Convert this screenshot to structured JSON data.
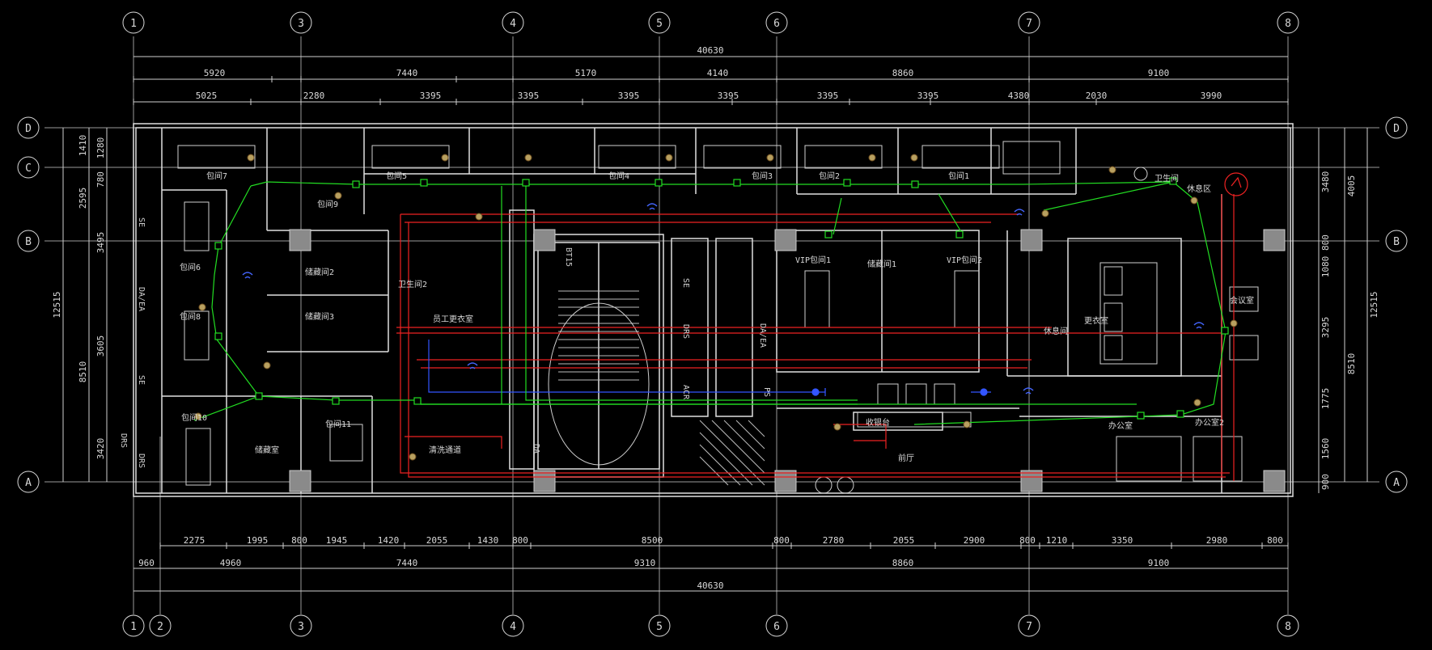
{
  "colors": {
    "background": "#000000",
    "lines": "#d9d9d9",
    "green_wiring": "#22dd22",
    "red_wiring": "#ee2222",
    "blue_wiring": "#3355ff",
    "fixture": "#b8a060"
  },
  "grid": {
    "top_labels": [
      "1",
      "3",
      "4",
      "5",
      "6",
      "7",
      "8"
    ],
    "bottom_labels": [
      "1",
      "2",
      "3",
      "4",
      "5",
      "6",
      "7",
      "8"
    ],
    "row_labels": [
      "D",
      "C",
      "B",
      "A"
    ]
  },
  "dimensions": {
    "total_top": "40630",
    "total_bottom": "40630",
    "top_row1": [
      "5920",
      "7440",
      "5170",
      "4140",
      "8860",
      "9100"
    ],
    "top_row2": [
      "5025",
      "2280",
      "3395",
      "3395",
      "3395",
      "3395",
      "3395",
      "3395",
      "4380",
      "2030",
      "3990"
    ],
    "bottom_row1": [
      "2275",
      "1995",
      "800",
      "1945",
      "1420",
      "2055",
      "1430",
      "800",
      "8500",
      "800",
      "2780",
      "2055",
      "2900",
      "800",
      "1210",
      "3350",
      "2980",
      "800"
    ],
    "bottom_row2": [
      "960",
      "4960",
      "7440",
      "9310",
      "8860",
      "9100"
    ],
    "left_total": "12515",
    "left_outer": [
      "2595",
      "8510",
      "3420"
    ],
    "left_inner": [
      "1410",
      "1280",
      "780",
      "3495",
      "3605"
    ],
    "right_total": "12515",
    "right_outer": [
      "4005",
      "8510"
    ],
    "right_inner": [
      "3480",
      "800",
      "1080",
      "3295",
      "1775",
      "1560",
      "900"
    ]
  },
  "rooms": [
    "包间7",
    "包间6",
    "包间5",
    "包间4",
    "包间3",
    "包间2",
    "包间1",
    "包间8",
    "包间9",
    "包间10",
    "包间11",
    "储藏间2",
    "储藏间3",
    "储藏间1",
    "卫生间2",
    "员工更衣室",
    "清洗通道",
    "储藏室",
    "VIP包间1",
    "VIP包间2",
    "卫生间",
    "休息区",
    "休息间",
    "更衣室",
    "会议室",
    "办公室",
    "办公室2",
    "前厅",
    "收银台"
  ],
  "shaft_labels": [
    "BT15",
    "SE",
    "DA/EA",
    "SE",
    "DRS",
    "DRS",
    "DA/EA",
    "SE",
    "ACR",
    "DA",
    "PS",
    "DRS"
  ]
}
